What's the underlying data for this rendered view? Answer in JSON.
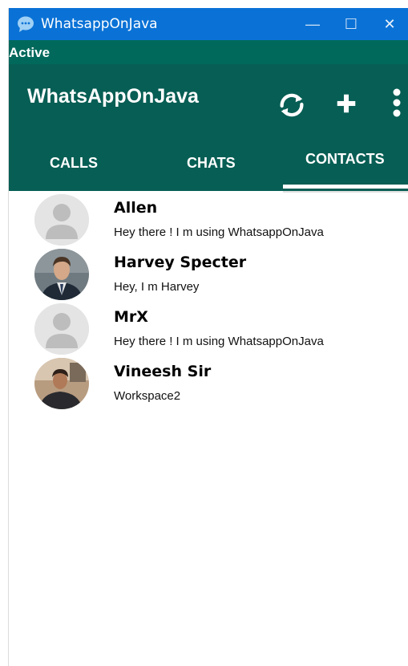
{
  "window": {
    "title": "WhatsappOnJava",
    "minimize_glyph": "—",
    "maximize_glyph": "☐",
    "close_glyph": "✕"
  },
  "status": {
    "label": "Active"
  },
  "header": {
    "app_name": "WhatsAppOnJava",
    "icons": [
      "refresh-icon",
      "add-icon",
      "more-vertical-icon"
    ]
  },
  "tabs": [
    {
      "label": "CALLS",
      "selected": false
    },
    {
      "label": "CHATS",
      "selected": false
    },
    {
      "label": "CONTACTS",
      "selected": true
    }
  ],
  "contacts": [
    {
      "name": "Allen",
      "status": "Hey there ! I m using WhatsappOnJava",
      "avatar": "default-avatar"
    },
    {
      "name": "Harvey Specter",
      "status": "Hey, I m Harvey",
      "avatar": "photo-avatar"
    },
    {
      "name": "MrX",
      "status": "Hey there ! I m using WhatsappOnJava",
      "avatar": "default-avatar"
    },
    {
      "name": "Vineesh Sir",
      "status": "Workspace2",
      "avatar": "photo-avatar"
    }
  ],
  "colors": {
    "titlebar": "#0a72d6",
    "status_strip": "#00695c",
    "header": "#075e54",
    "tab_indicator": "#ffffff"
  }
}
